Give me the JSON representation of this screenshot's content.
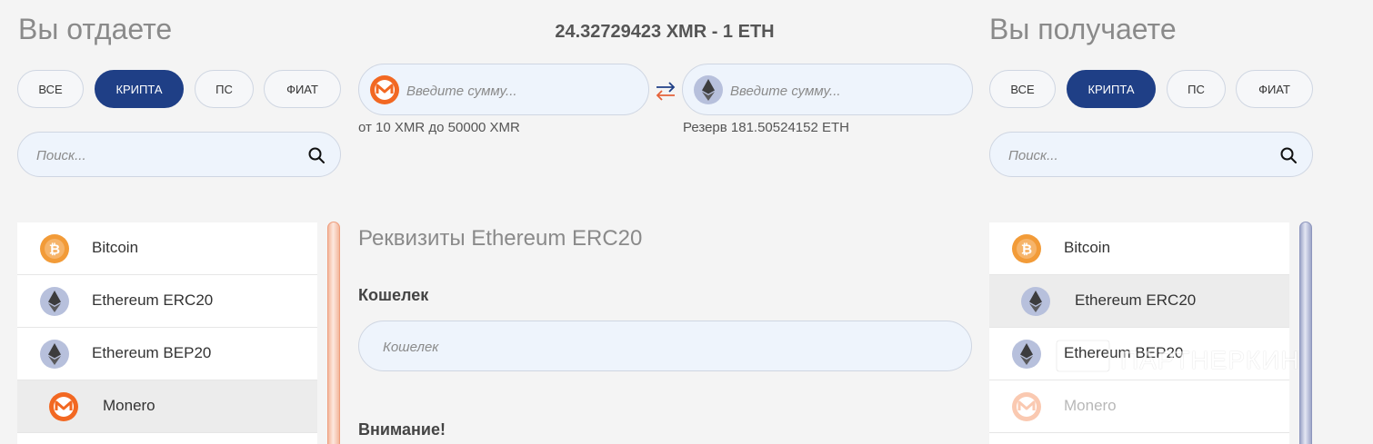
{
  "give": {
    "title": "Вы отдаете",
    "filters": [
      "ВСЕ",
      "КРИПТА",
      "ПС",
      "ФИАТ"
    ],
    "active_filter": "КРИПТА",
    "search_placeholder": "Поиск...",
    "list": [
      "Bitcoin",
      "Ethereum ERC20",
      "Ethereum BEP20",
      "Monero"
    ],
    "selected": "Monero"
  },
  "get": {
    "title": "Вы получаете",
    "filters": [
      "ВСЕ",
      "КРИПТА",
      "ПС",
      "ФИАТ"
    ],
    "active_filter": "КРИПТА",
    "search_placeholder": "Поиск...",
    "list": [
      "Bitcoin",
      "Ethereum ERC20",
      "Ethereum BEP20",
      "Monero"
    ],
    "selected": "Ethereum ERC20"
  },
  "exchange": {
    "rate": "24.32729423 XMR - 1 ETH",
    "from_placeholder": "Введите сумму...",
    "to_placeholder": "Введите сумму...",
    "from_limits": "от 10 XMR до 50000 XMR",
    "reserve": "Резерв 181.50524152 ETH"
  },
  "details": {
    "title": "Реквизиты Ethereum ERC20",
    "wallet_label": "Кошелек",
    "wallet_placeholder": "Кошелек",
    "notice_label": "Внимание!"
  },
  "watermark": "ПАРТНЕРКИН",
  "colors": {
    "accent": "#1f3f86",
    "bitcoin": "#f29b38",
    "monero": "#f26822",
    "ethereum_bg": "#b7c0dc",
    "ethereum": "#3c3c3d"
  }
}
